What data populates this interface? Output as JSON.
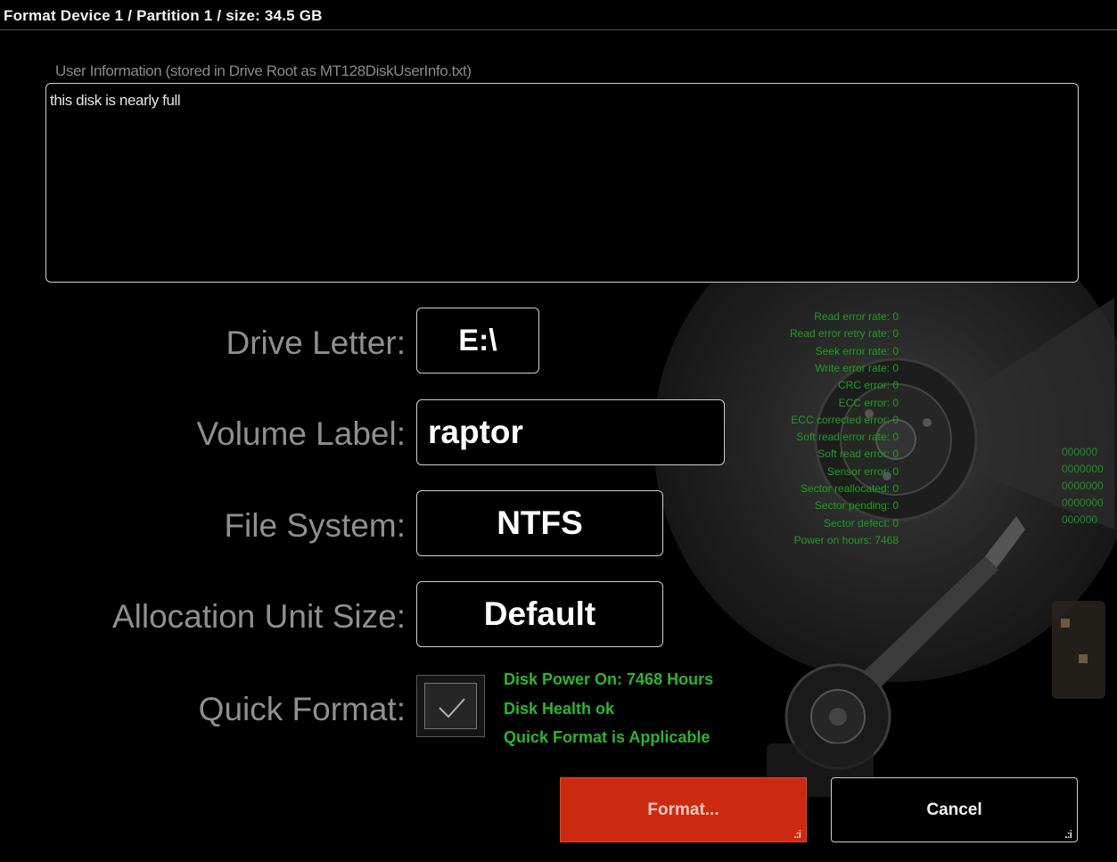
{
  "window": {
    "title": "Format Device 1 / Partition 1 / size: 34.5 GB"
  },
  "user_info": {
    "label": "User Information (stored in Drive Root as MT128DiskUserInfo.txt)",
    "value": "this disk is nearly full"
  },
  "form": {
    "drive_letter": {
      "label": "Drive Letter:",
      "value": "E:\\"
    },
    "volume_label": {
      "label": "Volume Label:",
      "value": "raptor"
    },
    "file_system": {
      "label": "File System:",
      "value": "NTFS"
    },
    "allocation_unit": {
      "label": "Allocation Unit Size:",
      "value": "Default"
    },
    "quick_format": {
      "label": "Quick Format:",
      "checked": true
    }
  },
  "status": {
    "power_on": "Disk Power On: 7468 Hours",
    "health": "Disk Health ok",
    "quick_format": "Quick Format is Applicable"
  },
  "smart": [
    "Read error rate: 0",
    "Read error retry rate: 0",
    "Seek error rate: 0",
    "Write error rate: 0",
    "CRC error: 0",
    "ECC error: 0",
    "ECC corrected error: 0",
    "Soft read error rate: 0",
    "Soft read error: 0",
    "Sensor error: 0",
    "Sector reallocated: 0",
    "Sector pending: 0",
    "Sector defect: 0",
    "Power on hours: 7468"
  ],
  "hex_lines": [
    "000000",
    "0000000",
    "0000000",
    "0000000",
    "000000"
  ],
  "buttons": {
    "format": "Format...",
    "cancel": "Cancel",
    "grip": ".:i"
  },
  "colors": {
    "accent_red": "#cc2a10",
    "status_green": "#2db52d",
    "smart_green": "#1f9e1f"
  }
}
